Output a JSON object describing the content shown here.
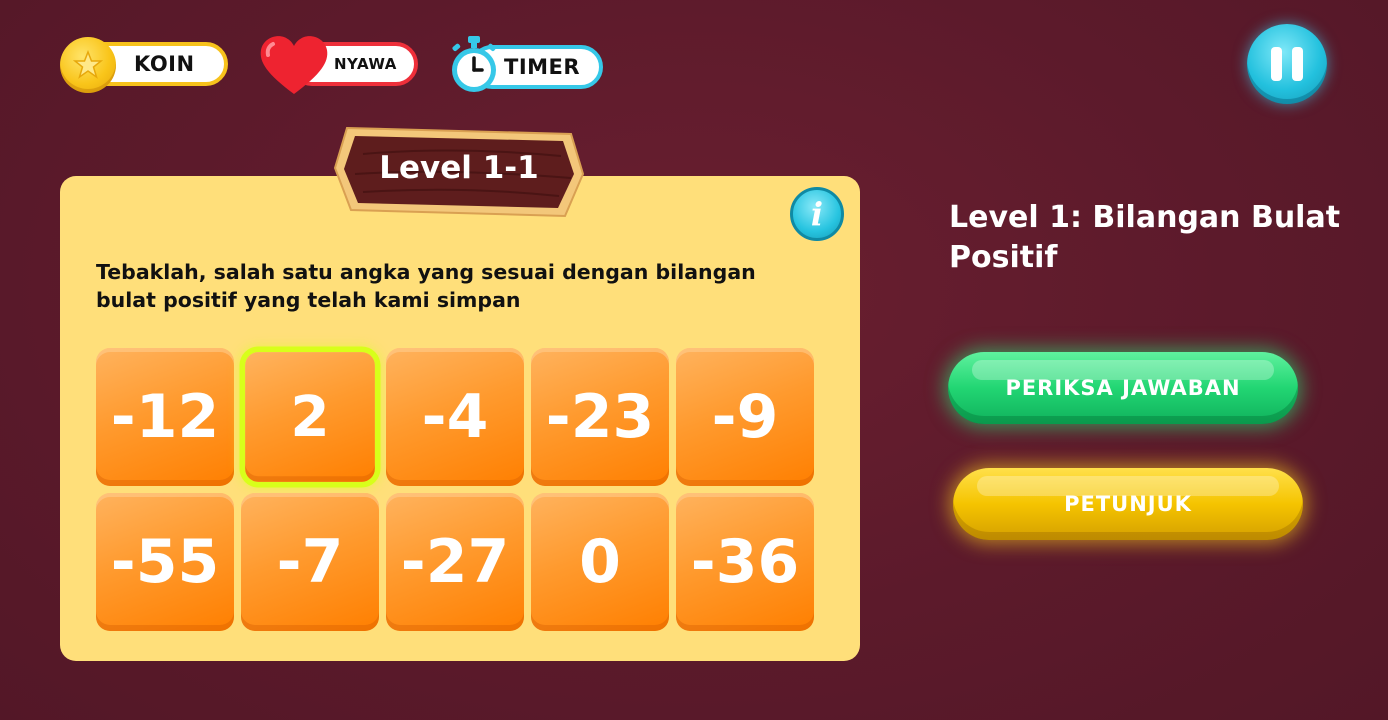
{
  "hud": {
    "koin_label": "KOIN",
    "nyawa_label": "NYAWA",
    "timer_label": "TIMER"
  },
  "card": {
    "level_label": "Level 1-1",
    "info_label": "i",
    "question": "Tebaklah, salah satu angka yang sesuai dengan bilangan bulat positif yang telah kami simpan",
    "tiles": [
      "-12",
      "2",
      "-4",
      "-23",
      "-9",
      "-55",
      "-7",
      "-27",
      "0",
      "-36"
    ],
    "selected_tile": "2"
  },
  "side": {
    "level_title": "Level 1: Bilangan Bulat Positif",
    "check_button": "PERIKSA JAWABAN",
    "hint_button": "PETUNJUK"
  },
  "icons": {
    "coin": "coin-icon",
    "heart": "heart-icon",
    "timer": "stopwatch-icon",
    "pause": "pause-icon",
    "info": "info-icon"
  },
  "colors": {
    "background": "#5c1a2b",
    "card": "#ffdf7a",
    "tile": "#ff8a16",
    "selected_outline": "#d8ff1a",
    "check_button": "#22d673",
    "hint_button": "#f5c400",
    "pause_button": "#23c1de"
  }
}
